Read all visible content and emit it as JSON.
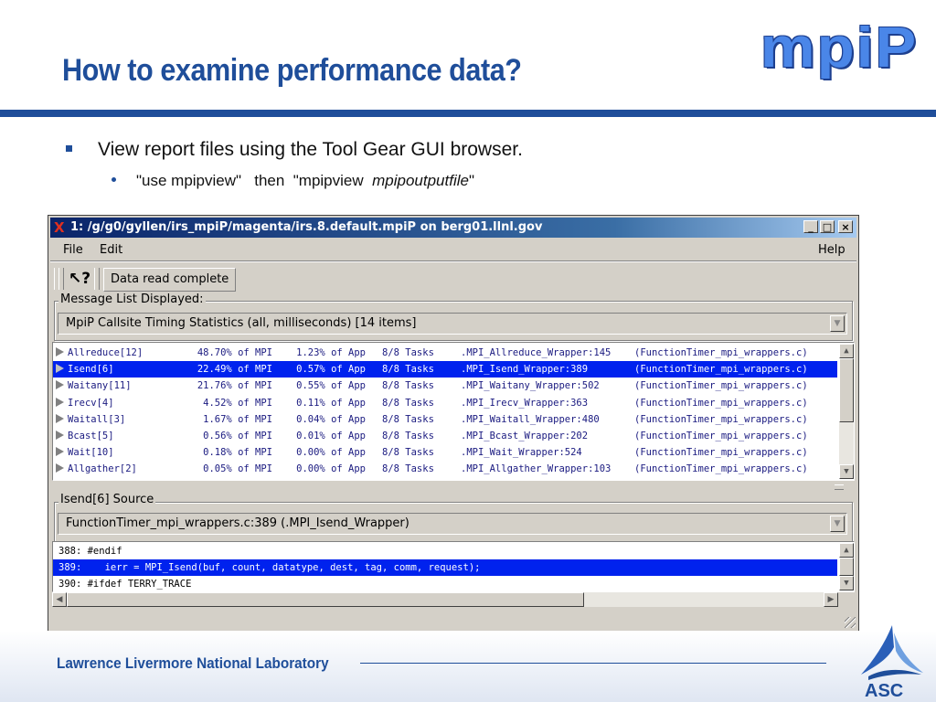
{
  "slide": {
    "title": "How to examine performance data?",
    "logo": "mpiP",
    "bullet": "View report files using the Tool Gear GUI browser.",
    "sub_bullet_part1": "\"use mpipview\"   then  \"mpipview  ",
    "sub_bullet_italic": "mpipoutputfile",
    "sub_bullet_part2": "\"",
    "footer": "Lawrence Livermore National Laboratory",
    "footer_logo": "ASC"
  },
  "window": {
    "title": "1: /g/g0/gyllen/irs_mpiP/magenta/irs.8.default.mpiP on berg01.llnl.gov",
    "app_icon": "X",
    "buttons": {
      "minimize": "_",
      "maximize": "□",
      "close": "×"
    },
    "menu": {
      "file": "File",
      "edit": "Edit",
      "help": "Help"
    },
    "toolbar": {
      "help_icon": "↖?",
      "status": "Data read complete"
    },
    "message_group_label": "Message List Displayed:",
    "message_combo_value": "MpiP Callsite Timing Statistics (all, milliseconds)  [14 items]",
    "callsites": [
      {
        "name": "Allreduce[12]",
        "mpi_pct": "48.70% of MPI",
        "app_pct": "1.23% of App",
        "tasks": "8/8 Tasks",
        "wrapper": ".MPI_Allreduce_Wrapper:145",
        "file": "(FunctionTimer_mpi_wrappers.c)"
      },
      {
        "name": "Isend[6]",
        "mpi_pct": "22.49% of MPI",
        "app_pct": "0.57% of App",
        "tasks": "8/8 Tasks",
        "wrapper": ".MPI_Isend_Wrapper:389",
        "file": "(FunctionTimer_mpi_wrappers.c)"
      },
      {
        "name": "Waitany[11]",
        "mpi_pct": "21.76% of MPI",
        "app_pct": "0.55% of App",
        "tasks": "8/8 Tasks",
        "wrapper": ".MPI_Waitany_Wrapper:502",
        "file": "(FunctionTimer_mpi_wrappers.c)"
      },
      {
        "name": "Irecv[4]",
        "mpi_pct": "4.52% of MPI",
        "app_pct": "0.11% of App",
        "tasks": "8/8 Tasks",
        "wrapper": ".MPI_Irecv_Wrapper:363",
        "file": "(FunctionTimer_mpi_wrappers.c)"
      },
      {
        "name": "Waitall[3]",
        "mpi_pct": "1.67% of MPI",
        "app_pct": "0.04% of App",
        "tasks": "8/8 Tasks",
        "wrapper": ".MPI_Waitall_Wrapper:480",
        "file": "(FunctionTimer_mpi_wrappers.c)"
      },
      {
        "name": "Bcast[5]",
        "mpi_pct": "0.56% of MPI",
        "app_pct": "0.01% of App",
        "tasks": "8/8 Tasks",
        "wrapper": ".MPI_Bcast_Wrapper:202",
        "file": "(FunctionTimer_mpi_wrappers.c)"
      },
      {
        "name": "Wait[10]",
        "mpi_pct": "0.18% of MPI",
        "app_pct": "0.00% of App",
        "tasks": "8/8 Tasks",
        "wrapper": ".MPI_Wait_Wrapper:524",
        "file": "(FunctionTimer_mpi_wrappers.c)"
      },
      {
        "name": "Allgather[2]",
        "mpi_pct": "0.05% of MPI",
        "app_pct": "0.00% of App",
        "tasks": "8/8 Tasks",
        "wrapper": ".MPI_Allgather_Wrapper:103",
        "file": "(FunctionTimer_mpi_wrappers.c)"
      }
    ],
    "selected_callsite_index": 1,
    "source_group_label": "Isend[6] Source",
    "source_combo_value": "FunctionTimer_mpi_wrappers.c:389 (.MPI_Isend_Wrapper)",
    "source_lines": [
      "388: #endif",
      "389:    ierr = MPI_Isend(buf, count, datatype, dest, tag, comm, request);",
      "390: #ifdef TERRY_TRACE"
    ],
    "selected_source_index": 1
  }
}
